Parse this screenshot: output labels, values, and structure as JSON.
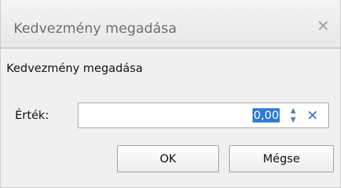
{
  "dialog": {
    "title": "Kedvezmény megadása",
    "close_glyph": "✕",
    "message": "Kedvezmény megadása"
  },
  "field": {
    "label": "Érték:",
    "value": "0,00",
    "spin_up_glyph": "▲",
    "spin_down_glyph": "▼",
    "clear_glyph": "✕"
  },
  "buttons": {
    "ok": "OK",
    "cancel": "Mégse"
  },
  "icons": {
    "close": "close-icon",
    "spin_up": "spin-up-icon",
    "spin_down": "spin-down-icon",
    "clear": "clear-icon"
  },
  "colors": {
    "selection": "#2f7ad8",
    "clear_icon": "#3b78c6"
  }
}
